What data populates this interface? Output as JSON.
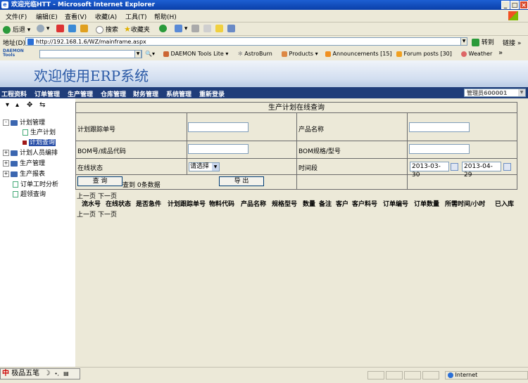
{
  "window": {
    "title": "欢迎光临HTT - Microsoft Internet Explorer"
  },
  "menu": [
    "文件(F)",
    "编辑(E)",
    "查看(V)",
    "收藏(A)",
    "工具(T)",
    "帮助(H)"
  ],
  "toolbar": {
    "back": "后退",
    "search": "搜索",
    "favorites": "收藏夹"
  },
  "address": {
    "label": "地址(D)",
    "url": "http://192.168.1.6/WZ/mainframe.aspx",
    "go": "转到",
    "links": "链接 »"
  },
  "daemon": {
    "logo": "DAEMON Tools",
    "tools": "DAEMON Tools Lite",
    "astroburn": "AstroBurn",
    "products": "Products",
    "announcements": "Announcements [15]",
    "forum": "Forum posts [30]",
    "weather": "Weather",
    "more": "»"
  },
  "erp": {
    "title": "欢迎使用ERP系统"
  },
  "nav": [
    "工程资料",
    "订单管理",
    "生产管理",
    "仓库管理",
    "财务管理",
    "系统管理",
    "重新登录"
  ],
  "user": {
    "value": "管理员600001"
  },
  "sidebar": {
    "tree": [
      {
        "label": "计划管理",
        "expander": "-"
      },
      {
        "label": "生产计划"
      },
      {
        "label": "计划查询"
      },
      {
        "label": "计划人员编排",
        "expander": "+"
      },
      {
        "label": "生产管理",
        "expander": "+"
      },
      {
        "label": "生产报表",
        "expander": "+"
      },
      {
        "label": "订单工时分析"
      },
      {
        "label": "超领查询"
      }
    ]
  },
  "form": {
    "title": "生产计划在线查询",
    "tracking_no_label": "计划跟踪单号",
    "product_name_label": "产品名称",
    "bom_label": "BOM号/成品代码",
    "bom_spec_label": "BOM规格/型号",
    "status_label": "在线状态",
    "status_value": "请选择",
    "period_label": "时间段",
    "date_from": "2013-03-30",
    "date_to": "2013-04-29",
    "query_button": "查 询",
    "result_text": "查到 0条数据",
    "export_button": "导 出"
  },
  "pager": {
    "prev": "上一页",
    "next": "下一页"
  },
  "table": {
    "columns": [
      "流水号",
      "在线状态",
      "是否急件",
      "计划跟踪单号",
      "物料代码",
      "产品名称",
      "规格型号",
      "数量",
      "备注",
      "客户",
      "客户料号",
      "订单编号",
      "订单数量",
      "所需时间/小时",
      "已入库"
    ]
  },
  "status": {
    "ime": "极品五笔",
    "zone": "Internet"
  }
}
